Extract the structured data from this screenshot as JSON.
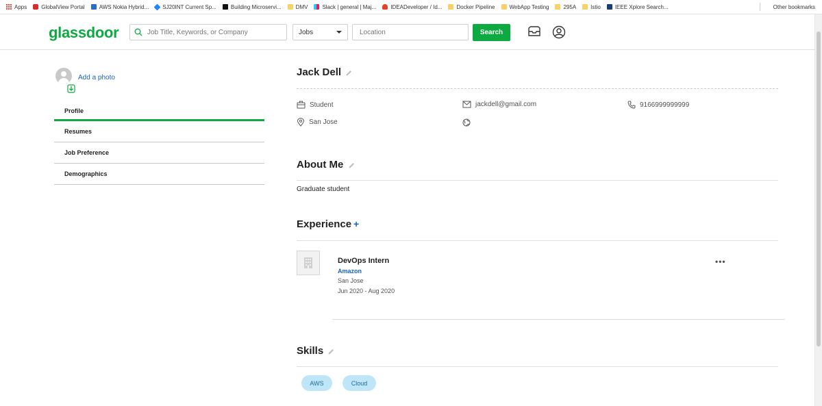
{
  "bookmarks": {
    "items": [
      {
        "label": "Apps",
        "icon": "apps-grid-icon"
      },
      {
        "label": "GlobalView Portal",
        "icon": "globalview-icon"
      },
      {
        "label": "AWS Nokia Hybrid...",
        "icon": "aws-icon"
      },
      {
        "label": "SJ20INT Current Sp...",
        "icon": "jira-icon"
      },
      {
        "label": "Building Microservi...",
        "icon": "medium-icon"
      },
      {
        "label": "DMV",
        "icon": "folder-icon"
      },
      {
        "label": "Slack | general | Maj...",
        "icon": "slack-icon"
      },
      {
        "label": "IDEADeveloper / Id...",
        "icon": "gitlab-icon"
      },
      {
        "label": "Docker Pipeline",
        "icon": "folder-icon"
      },
      {
        "label": "WebApp Testing",
        "icon": "folder-icon"
      },
      {
        "label": "295A",
        "icon": "folder-icon"
      },
      {
        "label": "Istio",
        "icon": "folder-icon"
      },
      {
        "label": "IEEE Xplore Search...",
        "icon": "ieee-icon"
      }
    ],
    "other": "Other bookmarks"
  },
  "header": {
    "logo": "glassdoor",
    "search_placeholder": "Job Title, Keywords, or Company",
    "category": "Jobs",
    "location_placeholder": "Location",
    "search_button": "Search"
  },
  "sidebar": {
    "add_photo": "Add a photo",
    "items": [
      "Profile",
      "Resumes",
      "Job Preference",
      "Demographics"
    ]
  },
  "profile": {
    "name": "Jack Dell",
    "occupation": "Student",
    "email": "jackdell@gmail.com",
    "phone": "9166999999999",
    "location": "San Jose"
  },
  "about": {
    "title": "About Me",
    "text": "Graduate student"
  },
  "experience": {
    "title": "Experience",
    "items": [
      {
        "role": "DevOps Intern",
        "company": "Amazon",
        "location": "San Jose",
        "dates": "Jun 2020 - Aug 2020"
      }
    ]
  },
  "skills": {
    "title": "Skills",
    "items": [
      "AWS",
      "Cloud"
    ]
  },
  "colors": {
    "brand_green": "#0caa41",
    "link_blue": "#1861bf",
    "chip_bg": "#bfe6f8"
  }
}
